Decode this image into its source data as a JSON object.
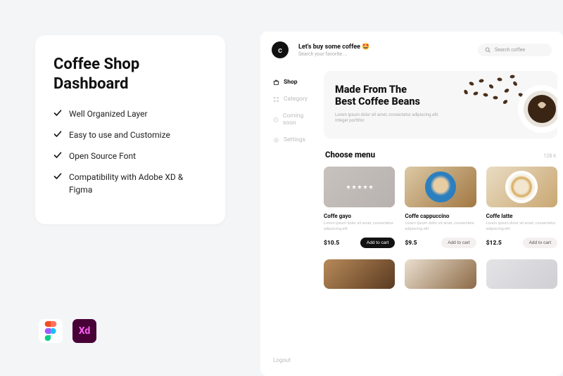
{
  "promo": {
    "title_line1": "Coffee Shop",
    "title_line2": "Dashboard",
    "features": [
      "Well Organized Layer",
      "Easy to use and Customize",
      "Open Source Font",
      "Compatibility with Adobe XD & Figma"
    ],
    "tools": {
      "figma": "Figma",
      "xd": "Xd"
    }
  },
  "app": {
    "logo_letter": "c",
    "top": {
      "tagline": "Let's buy some coffee 🤩",
      "subline": "Search your favorite ...",
      "search_placeholder": "Search coffee"
    },
    "sidebar": {
      "items": [
        {
          "label": "Shop",
          "active": true
        },
        {
          "label": "Category",
          "active": false
        },
        {
          "label": "Coming soon",
          "active": false
        },
        {
          "label": "Settings",
          "active": false
        }
      ],
      "logout": "Logout"
    },
    "hero": {
      "title_l1": "Made From The",
      "title_l2": "Best Coffee Beans",
      "subtitle": "Lorem ipsum dolor sit amet, consectetur adipiscing elit. Integer porttitor"
    },
    "menu": {
      "heading": "Choose menu",
      "count": "128 it",
      "products": [
        {
          "name": "Coffe gayo",
          "desc": "Lorem ipsum dolor sit amet, consectetur adipiscing elit",
          "price": "$10.5",
          "cta": "Add to cart",
          "primary": true,
          "variant": "blur"
        },
        {
          "name": "Coffe  cappuccino",
          "desc": "Lorem ipsum dolor sit amet, consectetur adipiscing elit",
          "price": "$9.5",
          "cta": "Add to cart",
          "primary": false,
          "variant": "cappu"
        },
        {
          "name": "Coffe latte",
          "desc": "Lorem ipsum dolor sit amet, consectetur adipiscing elit",
          "price": "$12.5",
          "cta": "Add to cart",
          "primary": false,
          "variant": "latte"
        }
      ]
    }
  }
}
